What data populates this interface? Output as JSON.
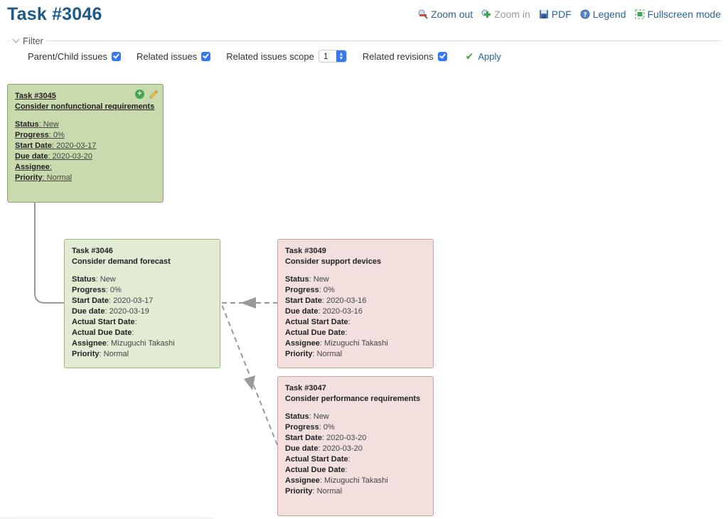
{
  "page": {
    "title": "Task #3046"
  },
  "toolbar": {
    "zoom_out": "Zoom out",
    "zoom_in": "Zoom in",
    "pdf": "PDF",
    "legend": "Legend",
    "fullscreen": "Fullscreen mode"
  },
  "filter": {
    "legend": "Filter",
    "parent_child_label": "Parent/Child issues",
    "parent_child_checked": true,
    "related_label": "Related issues",
    "related_checked": true,
    "scope_label": "Related issues scope",
    "scope_value": "1",
    "revisions_label": "Related revisions",
    "revisions_checked": true,
    "apply_label": "Apply"
  },
  "labels": {
    "status": "Status",
    "progress": "Progress",
    "start_date": "Start Date",
    "due_date": "Due date",
    "actual_start": "Actual Start Date",
    "actual_due": "Actual Due Date",
    "assignee": "Assignee",
    "priority": "Priority"
  },
  "nodes": [
    {
      "id": "Task #3045",
      "subject": "Consider nonfunctional requirements",
      "status": "New",
      "progress": "0%",
      "start_date": "2020-03-17",
      "due_date": "2020-03-20",
      "assignee": "",
      "priority": "Normal",
      "color": "#c9daae"
    },
    {
      "id": "Task #3046",
      "subject": "Consider demand forecast",
      "status": "New",
      "progress": "0%",
      "start_date": "2020-03-17",
      "due_date": "2020-03-19",
      "actual_start": "",
      "actual_due": "",
      "assignee": "Mizuguchi Takashi",
      "priority": "Normal",
      "color": "#e2ecd5"
    },
    {
      "id": "Task #3049",
      "subject": "Consider support devices",
      "status": "New",
      "progress": "0%",
      "start_date": "2020-03-16",
      "due_date": "2020-03-16",
      "actual_start": "",
      "actual_due": "",
      "assignee": "Mizuguchi Takashi",
      "priority": "Normal",
      "color": "#f2e0df"
    },
    {
      "id": "Task #3047",
      "subject": "Consider performance requirements",
      "status": "New",
      "progress": "0%",
      "start_date": "2020-03-20",
      "due_date": "2020-03-20",
      "actual_start": "",
      "actual_due": "",
      "assignee": "Mizuguchi Takashi",
      "priority": "Normal",
      "color": "#f2e0df"
    }
  ],
  "edges": [
    {
      "from": "Task #3045",
      "to": "Task #3046",
      "type": "parent-child"
    },
    {
      "from": "Task #3049",
      "to": "Task #3046",
      "type": "related"
    },
    {
      "from": "Task #3047",
      "to": "Task #3046",
      "type": "related"
    }
  ]
}
